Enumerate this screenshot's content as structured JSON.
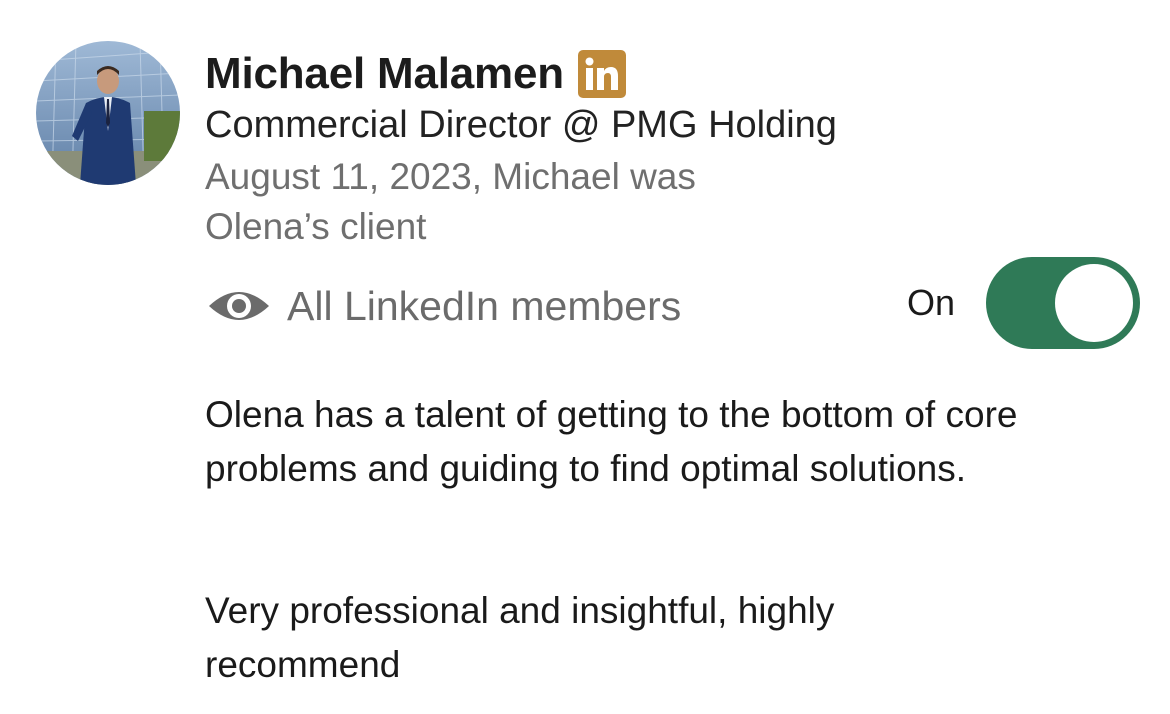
{
  "recommender": {
    "name": "Michael Malamen",
    "badge_icon": "linkedin-icon",
    "headline": "Commercial Director @ PMG Holding",
    "meta_line1": "August 11, 2023, Michael was",
    "meta_line2": "Olena’s client"
  },
  "visibility": {
    "icon": "eye-icon",
    "label": "All LinkedIn members",
    "toggle_label": "On",
    "toggle_on": true
  },
  "recommendation": {
    "paragraph1": "Olena has a talent of getting to the bottom of core problems and guiding to find optimal solutions.",
    "paragraph2": "Very professional and insightful, highly recommend"
  },
  "colors": {
    "toggle_on": "#2f7a57",
    "linkedin_badge": "#c08a3a",
    "secondary_text": "#6f6f6f"
  }
}
